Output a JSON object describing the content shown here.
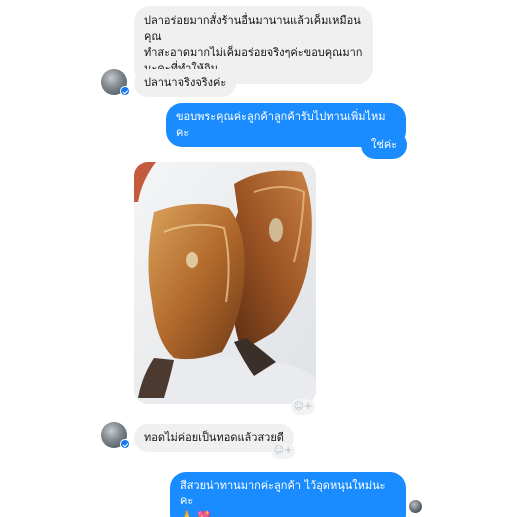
{
  "messages": {
    "msg1": "ปลาอร่อยมากสั่งร้านอื่นมานานแล้วเค็มเหมือนคุณทำสะอาดมากไม่เค็มอร่อยจริงๆค่ะขอบคุณมากนะคะที่ทำให้กิน",
    "msg1_lines": [
      "ปลาอร่อยมากสั่งร้านอื่นมานานแล้วเค็มเหมือนคุณ",
      "ทำสะอาดมากไม่เค็มอร่อยจริงๆค่ะขอบคุณมาก",
      "นะคะที่ทำให้กิน"
    ],
    "msg2": "ปลานาจริงจริงค่ะ",
    "msg3": "ขอบพระคุณค่ะลูกค้าลูกค้ารับไปทานเพิ่มไหมคะ",
    "msg4": "ใช่ค่ะ",
    "msg5": "ทอดไม่ค่อยเป็นทอดแล้วสวยดี",
    "msg6": "สีสวยน่าทานมากค่ะลูกค้า ไว้อุดหนุนใหม่นะคะ"
  },
  "icons": {
    "react": "add-reaction-icon",
    "emoji1": "folded-hands-emoji",
    "emoji2": "heart-emoji"
  },
  "colors": {
    "outgoing_bubble": "#1a8cff",
    "incoming_bubble": "#f0f0f0"
  }
}
